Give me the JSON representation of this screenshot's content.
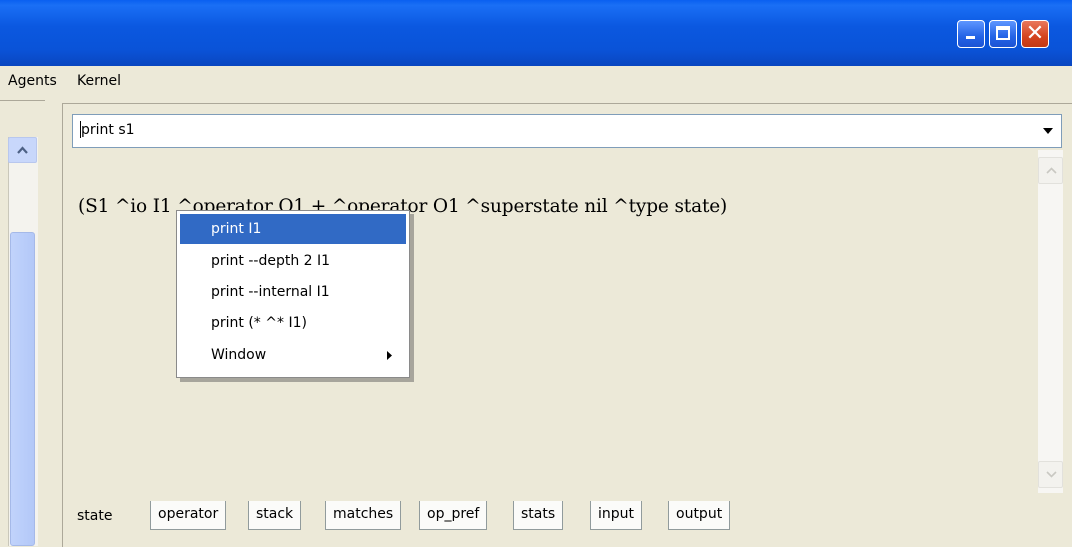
{
  "window": {
    "buttons": [
      "minimize",
      "maximize",
      "close"
    ]
  },
  "menubar": {
    "items": [
      "Agents",
      "Kernel"
    ]
  },
  "command": {
    "value": "print s1"
  },
  "output": {
    "text": "(S1 ^io I1 ^operator O1 + ^operator O1 ^superstate nil ^type state)"
  },
  "context_menu": {
    "items": [
      {
        "label": "print I1",
        "highlighted": true
      },
      {
        "label": "print --depth 2 I1"
      },
      {
        "label": "print --internal I1"
      },
      {
        "label": "print (* ^* I1)"
      },
      {
        "label": "Window",
        "submenu": true
      }
    ]
  },
  "tabs": [
    "state",
    "operator",
    "stack",
    "matches",
    "op_pref",
    "stats",
    "input",
    "output"
  ],
  "active_tab": "state",
  "colors": {
    "titlebar": "#0a53d8",
    "menu_highlight": "#316ac5",
    "background": "#ece9d8"
  }
}
